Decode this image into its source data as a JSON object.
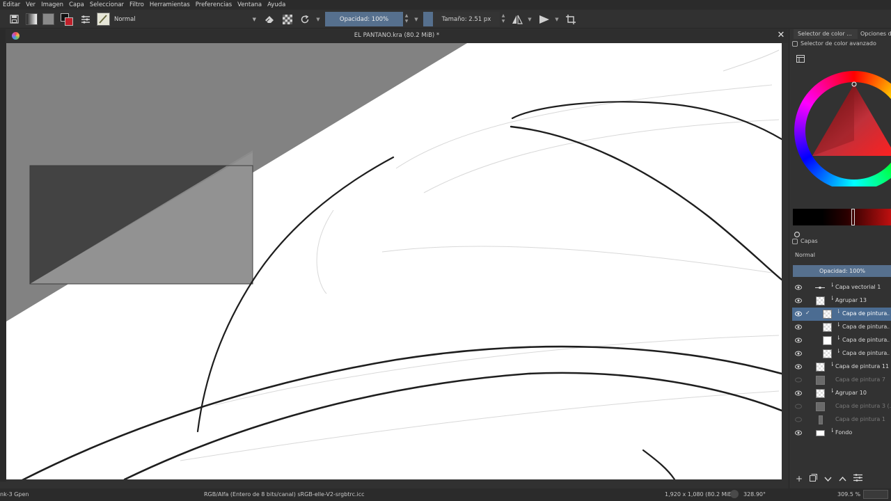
{
  "menu": [
    "Editar",
    "Ver",
    "Imagen",
    "Capa",
    "Seleccionar",
    "Filtro",
    "Herramientas",
    "Preferencias",
    "Ventana",
    "Ayuda"
  ],
  "toolbar": {
    "blend_mode": "Normal",
    "opacity_label": "Opacidad: 100%",
    "size_label": "Tamaño: 2.51 px"
  },
  "document": {
    "title": "EL PANTANO.kra (80.2 MiB) *",
    "close": "✕"
  },
  "dock": {
    "tab_color": "Selector de color ...",
    "tab_options": "Opciones de",
    "color_panel_title": "Selector de color avanzado",
    "layers_title": "Capas",
    "layers_blend": "Normal",
    "layers_opacity": "Opacidad:  100%",
    "layers": [
      {
        "name": "Capa vectorial 1",
        "visible": true,
        "type": "vector"
      },
      {
        "name": "Agrupar 13",
        "visible": true,
        "type": "group"
      },
      {
        "name": "Capa de pintura...",
        "visible": true,
        "type": "paint",
        "selected": true
      },
      {
        "name": "Capa de pintura...",
        "visible": true,
        "type": "paint"
      },
      {
        "name": "Capa de pintura...",
        "visible": true,
        "type": "paint"
      },
      {
        "name": "Capa de pintura...",
        "visible": true,
        "type": "paint"
      },
      {
        "name": "Capa de pintura 11",
        "visible": true,
        "type": "paint"
      },
      {
        "name": "Capa de pintura 7",
        "visible": false,
        "type": "paint"
      },
      {
        "name": "Agrupar 10",
        "visible": true,
        "type": "group"
      },
      {
        "name": "Capa de pintura 3 (...",
        "visible": false,
        "type": "paint"
      },
      {
        "name": "Capa de pintura 1",
        "visible": false,
        "type": "paint"
      },
      {
        "name": "Fondo",
        "visible": true,
        "type": "background"
      }
    ]
  },
  "status": {
    "brush": "nk-3 Gpen",
    "color_profile": "RGB/Alfa (Entero de 8 bits/canal)  sRGB-elle-V2-srgbtrc.icc",
    "dimensions": "1,920 x 1,080 (80.2 MiB)",
    "rotation": "328.90°",
    "zoom": "309.5 %"
  },
  "colors": {
    "accent": "#56708e",
    "selected_layer": "#4b6c92",
    "canvas": "#ffffff"
  }
}
